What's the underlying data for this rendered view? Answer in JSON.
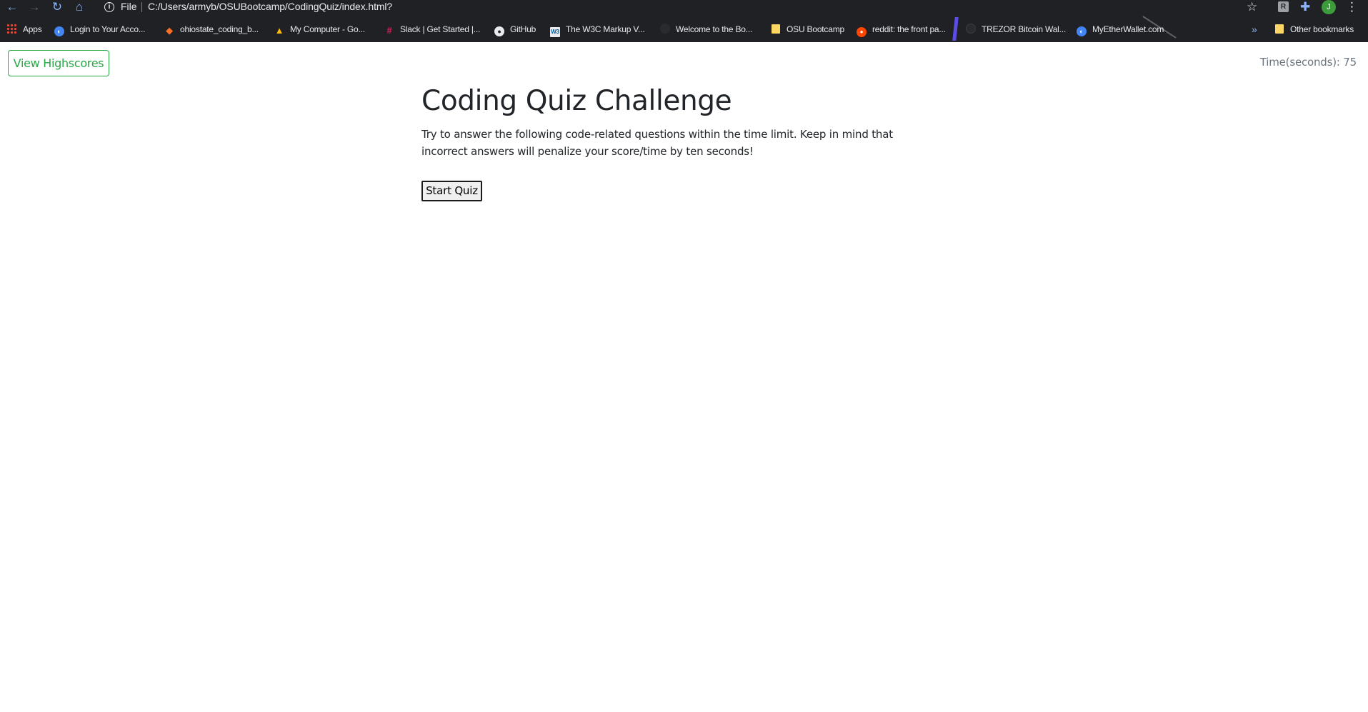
{
  "browser": {
    "scheme": "File",
    "url": "C:/Users/armyb/OSUBootcamp/CodingQuiz/index.html?",
    "avatar_initial": "J",
    "bookmarks": [
      {
        "label": "Apps",
        "icon": "apps-grid-icon"
      },
      {
        "label": "Login to Your Acco...",
        "icon": "globe-icon"
      },
      {
        "label": "ohiostate_coding_b...",
        "icon": "gitlab-icon"
      },
      {
        "label": "My Computer - Go...",
        "icon": "google-drive-icon"
      },
      {
        "label": "Slack | Get Started |...",
        "icon": "slack-icon"
      },
      {
        "label": "GitHub",
        "icon": "github-icon"
      },
      {
        "label": "The W3C Markup V...",
        "icon": "w3c-icon"
      },
      {
        "label": "Welcome to the Bo...",
        "icon": "site-icon"
      },
      {
        "label": "OSU Bootcamp",
        "icon": "folder-icon"
      },
      {
        "label": "reddit: the front pa...",
        "icon": "reddit-icon"
      },
      {
        "label": "TREZOR Bitcoin Wal...",
        "icon": "trezor-icon"
      },
      {
        "label": "MyEtherWallet.com",
        "icon": "globe-icon"
      }
    ],
    "other_bookmarks": "Other bookmarks",
    "chevron": "»"
  },
  "page": {
    "highscores_label": "View Highscores",
    "timer_text": "Time(seconds): 75",
    "title": "Coding Quiz Challenge",
    "description": "Try to answer the following code-related questions within the time limit. Keep in mind that incorrect answers will penalize your score/time by ten seconds!",
    "start_label": "Start Quiz"
  },
  "colors": {
    "success": "#28a745",
    "muted": "#6c757d",
    "chrome_bg": "#202124"
  }
}
